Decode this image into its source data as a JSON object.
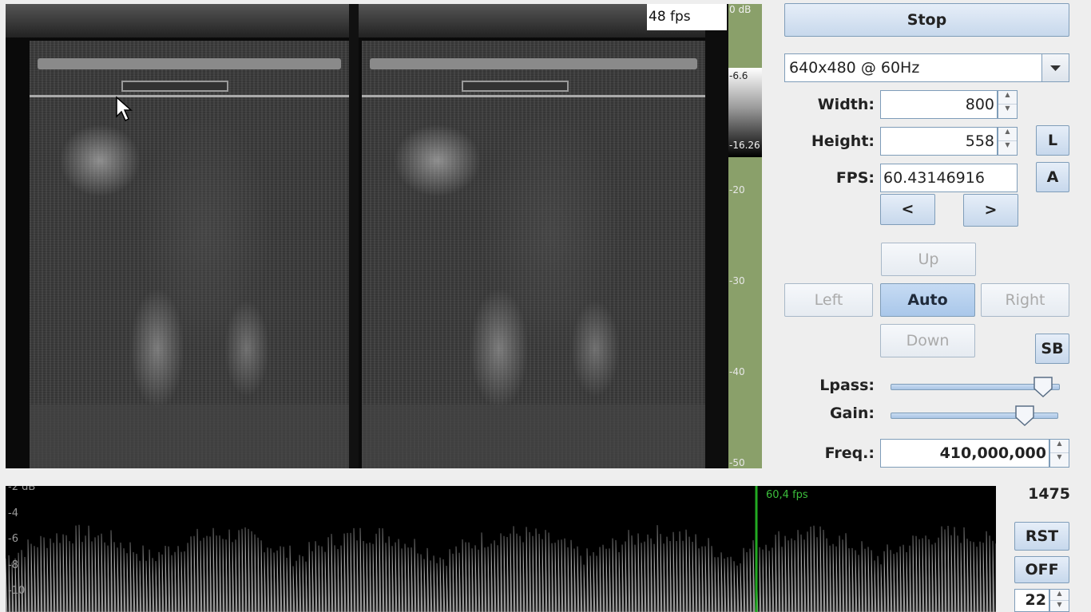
{
  "video": {
    "fps_overlay": "48 fps"
  },
  "meter": {
    "labels": [
      "0 dB",
      "-6.6",
      "-16.26",
      "-20",
      "-30",
      "-40",
      "-50"
    ],
    "color": "#8aa06a"
  },
  "controls": {
    "stop_label": "Stop",
    "mode_select": "640x480 @ 60Hz",
    "width_label": "Width:",
    "width_value": "800",
    "height_label": "Height:",
    "height_value": "558",
    "fps_label": "FPS:",
    "fps_value": "60.43146916",
    "l_button": "L",
    "a_button": "A",
    "prev_label": "<",
    "next_label": ">",
    "up_label": "Up",
    "left_label": "Left",
    "auto_label": "Auto",
    "right_label": "Right",
    "down_label": "Down",
    "sb_label": "SB",
    "lpass_label": "Lpass:",
    "lpass_level": 0.9,
    "gain_label": "Gain:",
    "gain_level": 0.8,
    "freq_label": "Freq.:",
    "freq_value": "410,000,000"
  },
  "spectrum": {
    "y_labels": [
      "-2 dB",
      "-4",
      "-6",
      "-8",
      "-10"
    ],
    "fps_marker": "60,4 fps",
    "marker_color": "#22aa22"
  },
  "bottom_right": {
    "count": "1475",
    "rst_label": "RST",
    "off_label": "OFF",
    "spinner_value": "22"
  }
}
